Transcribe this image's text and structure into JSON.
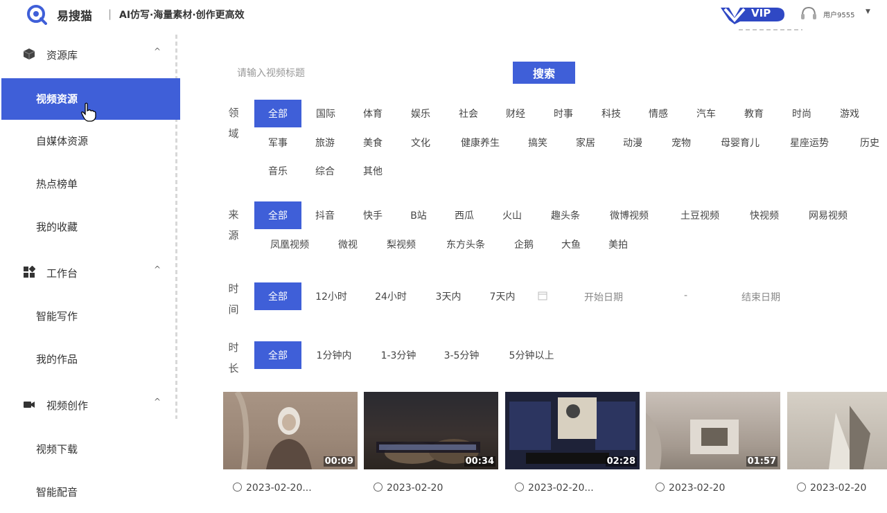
{
  "header": {
    "brand": "易搜猫",
    "separator": "|",
    "slogan": "AI仿写·海量素材·创作更高效",
    "vip_label": "VIP",
    "username": "用户9555",
    "caret": "▼"
  },
  "sidebar": {
    "groups": [
      {
        "label": "资源库",
        "arrow": "^"
      },
      {
        "label": "工作台",
        "arrow": "^"
      },
      {
        "label": "视频创作",
        "arrow": "^"
      }
    ],
    "items": [
      {
        "label": "视频资源"
      },
      {
        "label": "自媒体资源"
      },
      {
        "label": "热点榜单"
      },
      {
        "label": "我的收藏"
      },
      {
        "label": "智能写作"
      },
      {
        "label": "我的作品"
      },
      {
        "label": "视频下载"
      },
      {
        "label": "智能配音"
      }
    ]
  },
  "search": {
    "placeholder": "请输入视频标题",
    "button_label": "搜索"
  },
  "filters": {
    "domain": {
      "label_chars": [
        "领",
        "域"
      ],
      "options": [
        "全部",
        "国际",
        "体育",
        "娱乐",
        "社会",
        "财经",
        "时事",
        "科技",
        "情感",
        "汽车",
        "教育",
        "时尚",
        "游戏",
        "军事",
        "旅游",
        "美食",
        "文化",
        "健康养生",
        "搞笑",
        "家居",
        "动漫",
        "宠物",
        "母婴育儿",
        "星座运势",
        "历史",
        "音乐",
        "综合",
        "其他"
      ]
    },
    "source": {
      "label_chars": [
        "来",
        "源"
      ],
      "options": [
        "全部",
        "抖音",
        "快手",
        "B站",
        "西瓜",
        "火山",
        "趣头条",
        "微博视频",
        "土豆视频",
        "快视频",
        "网易视频",
        "凤凰视频",
        "微视",
        "梨视频",
        "东方头条",
        "企鹅",
        "大鱼",
        "美拍"
      ]
    },
    "time": {
      "label_chars": [
        "时",
        "间"
      ],
      "options": [
        "全部",
        "12小时",
        "24小时",
        "3天内",
        "7天内"
      ],
      "start_placeholder": "开始日期",
      "separator": "-",
      "end_placeholder": "结束日期"
    },
    "duration": {
      "label_chars": [
        "时",
        "长"
      ],
      "options": [
        "全部",
        "1分钟内",
        "1-3分钟",
        "3-5分钟",
        "5分钟以上"
      ]
    }
  },
  "videos": [
    {
      "duration": "00:09",
      "date": "2023-02-20..."
    },
    {
      "duration": "00:34",
      "date": "2023-02-20"
    },
    {
      "duration": "02:28",
      "date": "2023-02-20..."
    },
    {
      "duration": "01:57",
      "date": "2023-02-20"
    },
    {
      "duration": "",
      "date": "2023-02-20"
    }
  ],
  "colors": {
    "accent": "#3f5fd8",
    "text": "#333333",
    "muted": "#999999"
  }
}
